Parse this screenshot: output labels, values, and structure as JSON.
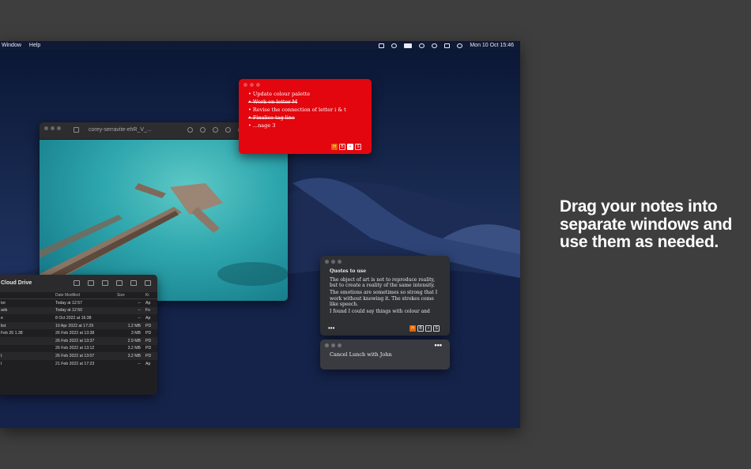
{
  "menubar": {
    "items": [
      "Window",
      "Help"
    ],
    "clock": "Mon 10 Oct 15:46",
    "status_icons": [
      "note-icon",
      "user-icon",
      "battery-icon",
      "wifi-icon",
      "search-icon",
      "control-center-icon",
      "siri-icon"
    ]
  },
  "red_note": {
    "items": [
      {
        "text": "Update colour palette",
        "done": false
      },
      {
        "text": "Work on letter M",
        "done": true
      },
      {
        "text": "Revise the connection of letter i & t",
        "done": false
      },
      {
        "text": "Finalise tag line",
        "done": true
      },
      {
        "text": "...nage 3",
        "done": false
      }
    ],
    "format_buttons": [
      "H",
      "B",
      "•",
      "S"
    ]
  },
  "preview_window": {
    "title": "corey-serravite-ehR_V_..."
  },
  "finder": {
    "title": "Cloud Drive",
    "columns": [
      "",
      "Date Modified",
      "Size",
      "Ki"
    ],
    "rows": [
      [
        "tor",
        "Today at 12:57",
        "--",
        "Ap"
      ],
      [
        "ads",
        "Today at 12:50",
        "--",
        "Fo"
      ],
      [
        "e",
        "8 Oct 2022 at 16:38",
        "--",
        "Ap"
      ],
      [
        "list",
        "10 Apr 2022 at 17:29",
        "1.2 MB",
        "PD"
      ],
      [
        "Feb 26 1.38",
        "26 Feb 2022 at 13:38",
        "3 MB",
        "PD"
      ],
      [
        "",
        "26 Feb 2022 at 13:37",
        "2.9 MB",
        "PD"
      ],
      [
        "",
        "26 Feb 2022 at 13:12",
        "3.2 MB",
        "PD"
      ],
      [
        "t",
        "26 Feb 2022 at 13:07",
        "3.2 MB",
        "PD"
      ],
      [
        "l",
        "21 Feb 2022 at 17:23",
        "--",
        "Ap"
      ]
    ]
  },
  "quotes_note": {
    "heading": "Quotes to use",
    "paragraphs": [
      "The object of art is not to reproduce reality, but to create a reality of the same intensity.",
      "The emotions are sometimes so strong that I work without knowing it. The strokes come like speech.",
      "I found I could say things with colour and"
    ],
    "more": "•••",
    "format_buttons": [
      "H",
      "B",
      "•",
      "S"
    ]
  },
  "lunch_note": {
    "text": "Cancel Lunch with John",
    "more": "•••"
  },
  "caption": "Drag your notes into separate windows and use them as needed."
}
